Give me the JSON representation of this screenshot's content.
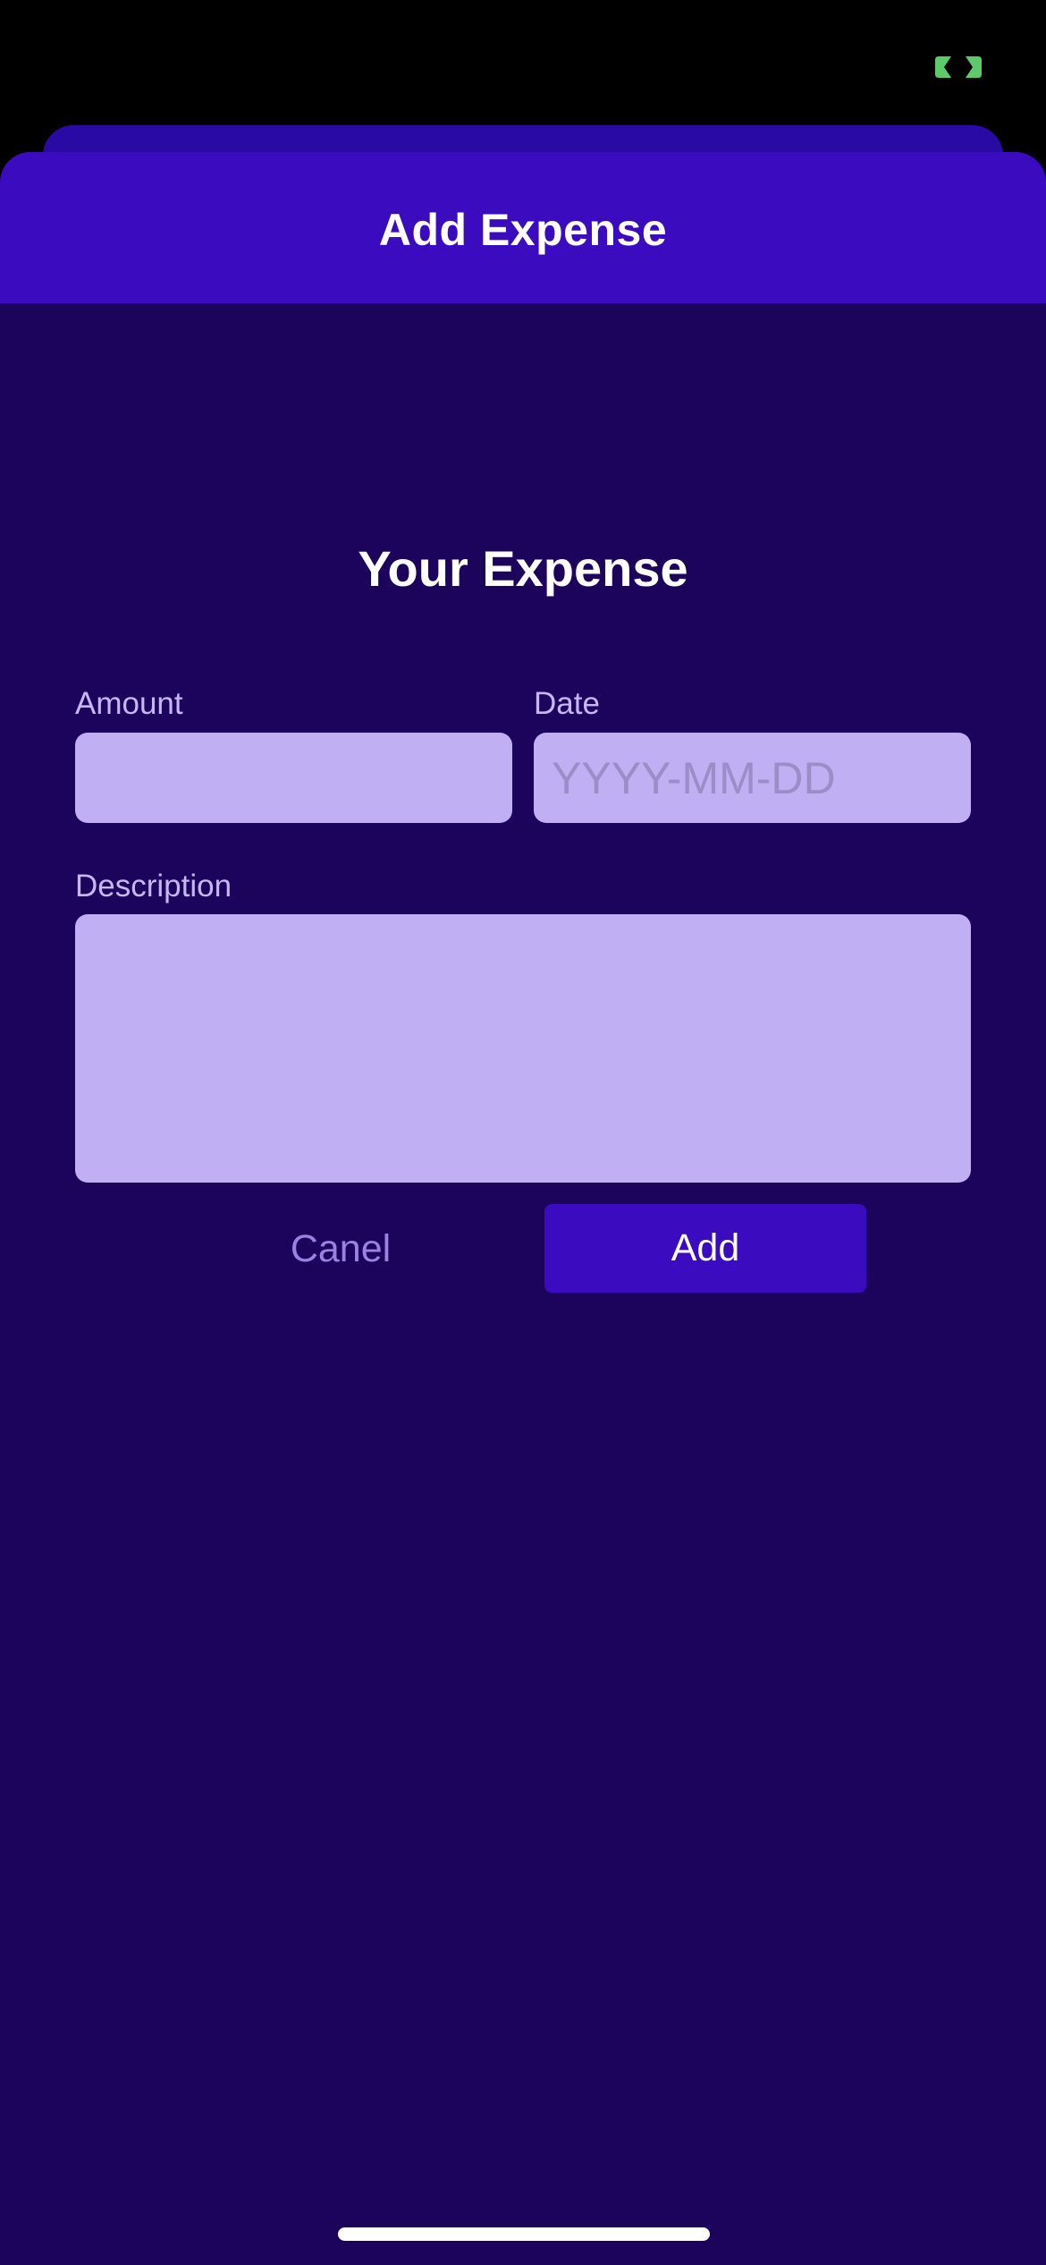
{
  "status_bar": {
    "indicator_icon": "camera-in-use-indicator-icon",
    "indicator_color": "#5dca6a"
  },
  "header": {
    "title": "Add Expense"
  },
  "form": {
    "title": "Your Expense",
    "amount": {
      "label": "Amount",
      "value": "",
      "placeholder": ""
    },
    "date": {
      "label": "Date",
      "value": "",
      "placeholder": "YYYY-MM-DD"
    },
    "description": {
      "label": "Description",
      "value": "",
      "placeholder": ""
    },
    "cancel_label": "Canel",
    "add_label": "Add"
  },
  "colors": {
    "background": "#1c035c",
    "header": "#3a0bbf",
    "input": "#c1aff4",
    "label": "#c8b6f2",
    "cancel_text": "#9b82e2",
    "accent": "#3a0bbf"
  }
}
